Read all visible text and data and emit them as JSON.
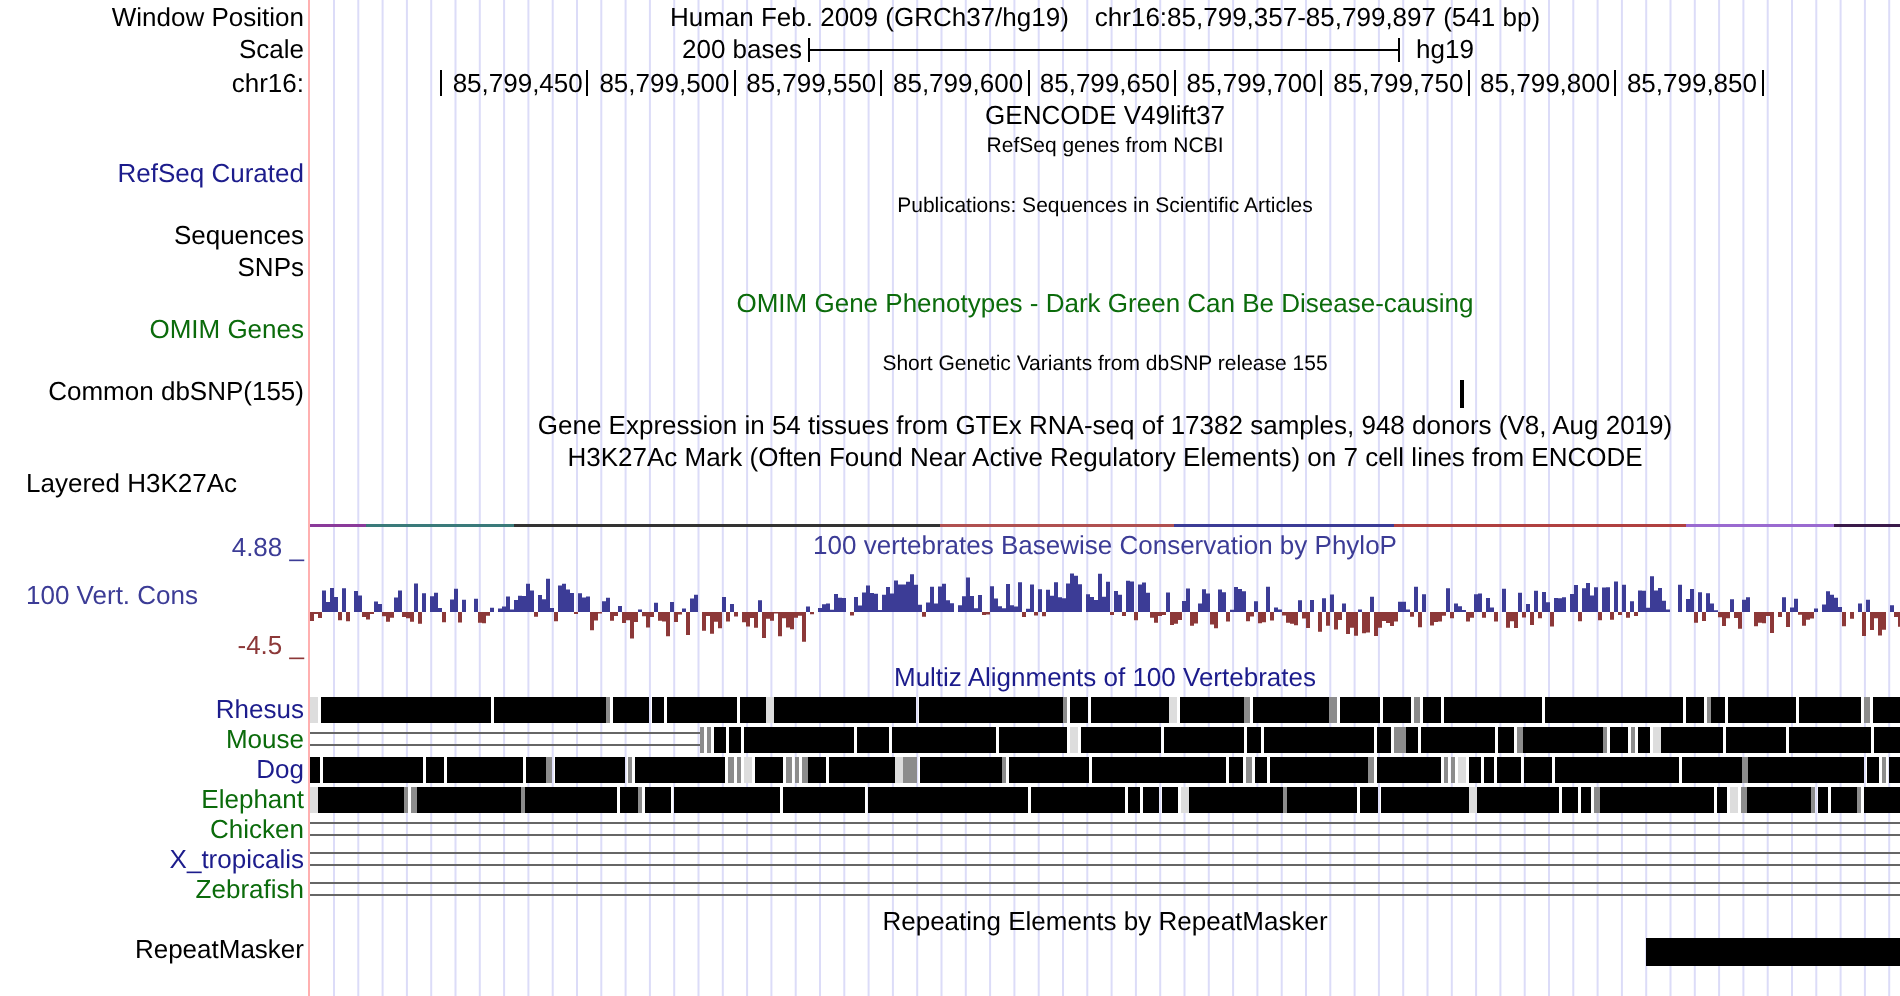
{
  "header": {
    "label": "Window Position",
    "assembly": "Human Feb. 2009 (GRCh37/hg19)",
    "position": "chr16:85,799,357-85,799,897 (541 bp)"
  },
  "scale": {
    "label": "Scale",
    "length": "200 bases",
    "db": "hg19"
  },
  "ruler": {
    "label": "chr16:",
    "ticks": [
      "85,799,450",
      "85,799,500",
      "85,799,550",
      "85,799,600",
      "85,799,650",
      "85,799,700",
      "85,799,750",
      "85,799,800",
      "85,799,850"
    ]
  },
  "track_labels": [
    {
      "text": "RefSeq Curated",
      "color": "#1c1c8c",
      "kind": "track"
    },
    {
      "text": "Sequences",
      "color": "#000000",
      "kind": "track"
    },
    {
      "text": "SNPs",
      "color": "#000000",
      "kind": "track"
    },
    {
      "text": "OMIM Genes",
      "color": "#0b6b0b",
      "kind": "track"
    },
    {
      "text": "Common dbSNP(155)",
      "color": "#000000",
      "kind": "track"
    },
    {
      "text": "Layered H3K27Ac",
      "color": "#000000",
      "kind": "composite"
    },
    {
      "text": "4.88 _",
      "color": "#3c3c96",
      "kind": "axis"
    },
    {
      "text": "100 Vert. Cons",
      "color": "#3c3c96",
      "kind": "composite"
    },
    {
      "text": "-4.5 _",
      "color": "#8c3838",
      "kind": "axis"
    }
  ],
  "tracks": [
    {
      "kind": "title",
      "text": "GENCODE V49lift37",
      "color": "#000000"
    },
    {
      "kind": "caption",
      "text": "RefSeq genes from NCBI",
      "color": "#000000"
    },
    {
      "kind": "caption",
      "text": "Publications: Sequences in Scientific Articles",
      "color": "#000000"
    },
    {
      "kind": "title",
      "text": "OMIM Gene Phenotypes - Dark Green Can Be Disease-causing",
      "color": "#0b6b0b"
    },
    {
      "kind": "caption",
      "text": "Short Genetic Variants from dbSNP release 155",
      "color": "#000000"
    },
    {
      "kind": "snp"
    },
    {
      "kind": "title",
      "text": "Gene Expression in 54 tissues from GTEx RNA-seq of 17382 samples, 948 donors (V8, Aug 2019)",
      "color": "#000000"
    },
    {
      "kind": "title",
      "text": "H3K27Ac Mark (Often Found Near Active Regulatory Elements) on 7 cell lines from ENCODE",
      "color": "#000000"
    },
    {
      "kind": "signal"
    },
    {
      "kind": "title",
      "text": "100 vertebrates Basewise Conservation by PhyloP",
      "color": "#3c3c96"
    },
    {
      "kind": "wiggle"
    },
    {
      "kind": "title",
      "text": "Multiz Alignments of 100 Vertebrates",
      "color": "#1c1c8c"
    }
  ],
  "species": [
    {
      "name": "Rhesus",
      "color": "#1c1c8c",
      "kind": "full"
    },
    {
      "name": "Mouse",
      "color": "#0b6b0b",
      "kind": "partial"
    },
    {
      "name": "Dog",
      "color": "#1c1c8c",
      "kind": "full"
    },
    {
      "name": "Elephant",
      "color": "#0b6b0b",
      "kind": "full"
    },
    {
      "name": "Chicken",
      "color": "#0b6b0b",
      "kind": "none"
    },
    {
      "name": "X_tropicalis",
      "color": "#1c1c8c",
      "kind": "none"
    },
    {
      "name": "Zebrafish",
      "color": "#0b6b0b",
      "kind": "none"
    }
  ],
  "repeats": {
    "label": "RepeatMasker",
    "title": "Repeating Elements by RepeatMasker"
  }
}
